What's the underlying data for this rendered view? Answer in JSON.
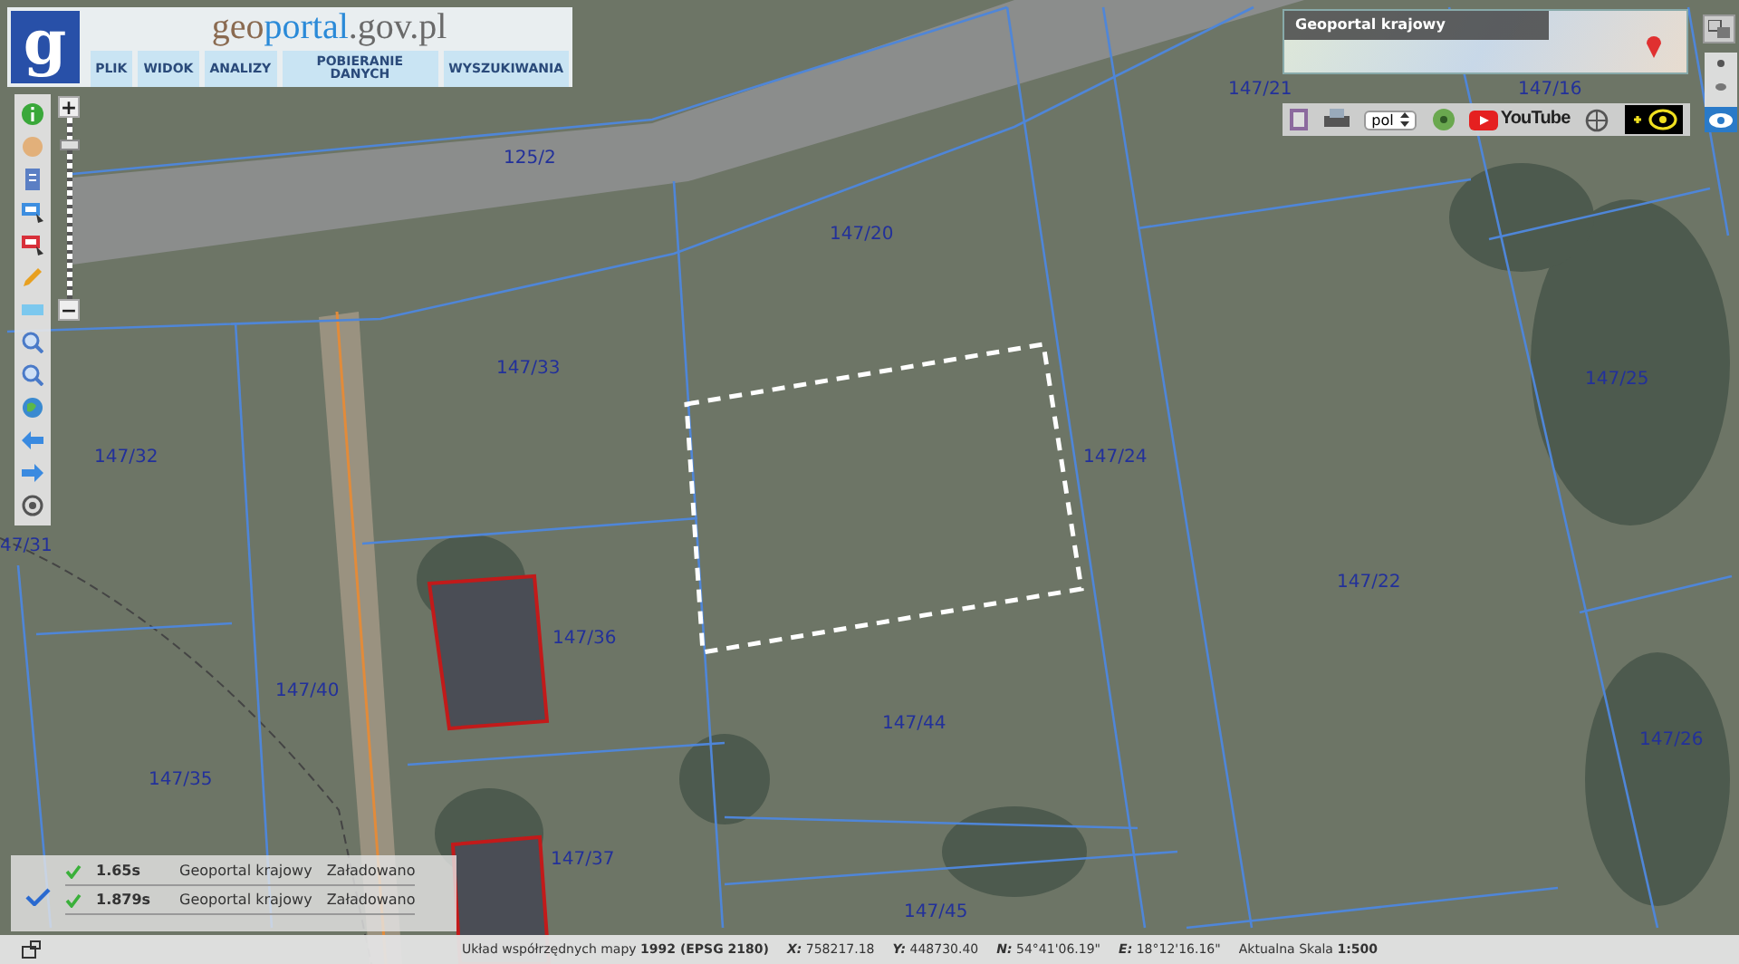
{
  "header": {
    "logo_letter": "g",
    "title": {
      "prefix": "geo",
      "main": "portal",
      "suffix": ".gov.pl"
    },
    "menu": [
      "PLIK",
      "WIDOK",
      "ANALIZY",
      "POBIERANIE DANYCH",
      "WYSZUKIWANIA"
    ]
  },
  "zoom_slider": {
    "plus": "+",
    "minus": "−",
    "level": 0.88
  },
  "minimap": {
    "title": "Geoportal krajowy"
  },
  "top_toolbar": {
    "language": "pol",
    "video_link": "YouTube"
  },
  "parcels": [
    "147/21",
    "147/16",
    "125/2",
    "147/20",
    "147/33",
    "147/25",
    "147/32",
    "147/24",
    "47/31",
    "147/22",
    "147/36",
    "147/40",
    "147/26",
    "147/44",
    "147/35",
    "147/37",
    "147/45"
  ],
  "status_panel": {
    "checked": true,
    "rows": [
      {
        "done": true,
        "time": "1.65s",
        "source": "Geoportal krajowy",
        "status": "Załadowano"
      },
      {
        "done": true,
        "time": "1.879s",
        "source": "Geoportal krajowy",
        "status": "Załadowano"
      }
    ]
  },
  "status_bar": {
    "coordinate_system": {
      "label": "Układ współrzędnych mapy",
      "value": "1992 (EPSG 2180)"
    },
    "coordinates": [
      {
        "label": "X:",
        "value": "758217.18"
      },
      {
        "label": "Y:",
        "value": "448730.40"
      },
      {
        "label": "N:",
        "value": "54°41'06.19\""
      },
      {
        "label": "E:",
        "value": "18°12'16.16\""
      }
    ],
    "scale": {
      "label": "Aktualna Skala",
      "value": "1:500"
    }
  }
}
